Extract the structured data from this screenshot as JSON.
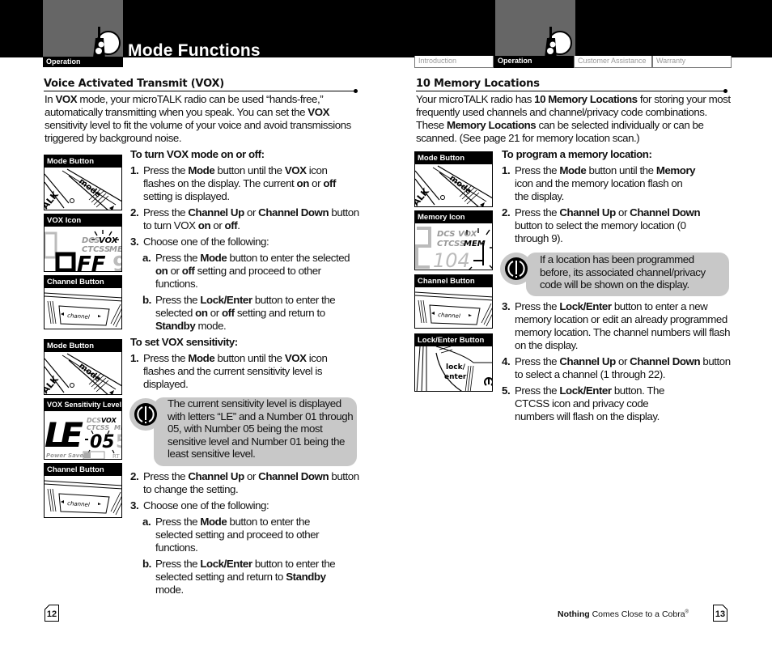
{
  "header": {
    "title": "Mode Functions",
    "left_tab": "Operation",
    "nav_tabs": [
      {
        "label": "Introduction",
        "active": false
      },
      {
        "label": "Operation",
        "active": true
      },
      {
        "label": "Customer Assistance",
        "active": false
      },
      {
        "label": "Warranty",
        "active": false
      }
    ]
  },
  "left_page": {
    "section_title": "Voice Activated Transmit (VOX)",
    "intro_parts": {
      "p1": "In ",
      "b1": "VOX",
      "p2": " mode, your microTALK radio can be used “hands-free,” automatically transmitting when you speak. You can set the ",
      "b2": "VOX",
      "p3": " sensitivity level to fit the volume of your voice and avoid transmissions triggered by background noise."
    },
    "thumbs": [
      {
        "label": "Mode Button",
        "key_text": "mode",
        "side_text": "ALK"
      },
      {
        "label": "VOX Icon",
        "lcd_top": "DCS VOX",
        "lcd_mid": "CTCSS MEM",
        "lcd_big": "OFF"
      },
      {
        "label": "Channel Button",
        "key_text": "channel"
      },
      {
        "label": "Mode Button",
        "key_text": "mode",
        "side_text": "ALK"
      },
      {
        "label": "VOX Sensitivity Level",
        "lcd_top": "DCS VOX",
        "lcd_mid": "CTCSS MEM",
        "lcd_big": "LE-05",
        "lcd_bottom": "Power Saver",
        "lcd_rt": "RT"
      },
      {
        "label": "Channel Button",
        "key_text": "channel"
      }
    ],
    "vox_onoff": {
      "heading": "To turn VOX mode on or off:",
      "steps": [
        {
          "num": "1.",
          "t1": "Press the ",
          "b1": "Mode",
          "t2": " button until the ",
          "b2": "VOX",
          "t3": " icon flashes on the display. The current ",
          "b3": "on",
          "t4": " or ",
          "b4": "off",
          "t5": " setting is displayed."
        },
        {
          "num": "2.",
          "t1": "Press the ",
          "b1": "Channel Up",
          "t2": " or ",
          "b2": "Channel Down",
          "t3": " button to turn VOX ",
          "b3": "on",
          "t4": " or ",
          "b4": "off",
          "t5": "."
        },
        {
          "num": "3.",
          "t1": "Choose one of the following:"
        }
      ],
      "sub_steps": [
        {
          "num": "a.",
          "t1": "Press the ",
          "b1": "Mode",
          "t2": " button to enter the selected ",
          "b2": "on",
          "t3": " or ",
          "b3": "off",
          "t4": " setting and proceed to other functions."
        },
        {
          "num": "b.",
          "t1": "Press the ",
          "b1": "Lock/Enter",
          "t2": " button to enter the selected ",
          "b2": "on",
          "t3": " or ",
          "b3": "off",
          "t4": " setting and return to ",
          "b4": "Standby",
          "t5": " mode."
        }
      ]
    },
    "vox_sens": {
      "heading": "To set VOX sensitivity:",
      "step1": {
        "num": "1.",
        "t1": "Press the ",
        "b1": "Mode",
        "t2": " button until the ",
        "b2": "VOX",
        "t3": " icon flashes and the current sensitivity level is displayed."
      },
      "note": "The current sensitivity level is displayed with letters “LE” and a Number 01 through 05, with Number 05 being the most sensitive level and Number 01 being the least sensitive level.",
      "step2": {
        "num": "2.",
        "t1": "Press the ",
        "b1": "Channel Up",
        "t2": " or ",
        "b2": "Channel Down",
        "t3": " button to change the setting."
      },
      "step3": {
        "num": "3.",
        "t1": "Choose one of the following:"
      },
      "sub_steps": [
        {
          "num": "a.",
          "t1": "Press the ",
          "b1": "Mode",
          "t2": " button to enter the selected setting and proceed to other functions."
        },
        {
          "num": "b.",
          "t1": "Press the ",
          "b1": "Lock/Enter",
          "t2": " button to enter the selected setting and return to ",
          "b2": "Standby",
          "t3": " mode."
        }
      ]
    },
    "page_number": "12"
  },
  "right_page": {
    "section_title": "10 Memory Locations",
    "intro_parts": {
      "p1": "Your microTALK radio has ",
      "b1": "10 Memory Locations",
      "p2": " for storing your most frequently used channels and channel/privacy code combinations. These ",
      "b2": "Memory Locations",
      "p3": " can be selected individually or can be scanned. (See page 21 for memory location scan.)"
    },
    "thumbs": [
      {
        "label": "Mode Button",
        "key_text": "mode",
        "side_text": "ALK"
      },
      {
        "label": "Memory Icon",
        "lcd_top": "DCS VOX",
        "lcd_mid": "CTCSS MEM",
        "lcd_big": "104"
      },
      {
        "label": "Channel Button",
        "key_text": "channel"
      },
      {
        "label": "Lock/Enter Button",
        "key_text": "lock/ enter"
      }
    ],
    "program": {
      "heading": "To program a memory location:",
      "steps": [
        {
          "num": "1.",
          "t1": "Press the ",
          "b1": "Mode",
          "t2": " button until the ",
          "b2": "Memory",
          "t3": " icon and the memory location flash on the display."
        },
        {
          "num": "2.",
          "t1": "Press the ",
          "b1": "Channel Up",
          "t2": " or ",
          "b2": "Channel Down",
          "t3": " button to select the memory location (0 through 9)."
        }
      ],
      "note": "If a location has been programmed before, its associated channel/privacy code will be shown on the display.",
      "steps2": [
        {
          "num": "3.",
          "t1": "Press the ",
          "b1": "Lock/Enter",
          "t2": " button to enter a new memory location or edit an already programmed memory location. The channel numbers will flash on the display."
        },
        {
          "num": "4.",
          "t1": "Press the ",
          "b1": "Channel Up",
          "t2": " or ",
          "b2": "Channel Down",
          "t3": " button to select a channel (1 through 22)."
        },
        {
          "num": "5.",
          "t1": "Press the ",
          "b1": "Lock/Enter",
          "t2": " button. The CTCSS icon and privacy code numbers will flash on the display."
        }
      ]
    },
    "tagline_bold": "Nothing",
    "tagline_rest": " Comes Close to a Cobra",
    "tagline_mark": "®",
    "page_number": "13"
  },
  "icons": {
    "header_icon": "walkie-talkie-icon",
    "note_icon": "info-alert-icon"
  },
  "colors": {
    "header_bg": "#000000",
    "header_block": "#666666",
    "note_bg": "#c8c8c8"
  }
}
